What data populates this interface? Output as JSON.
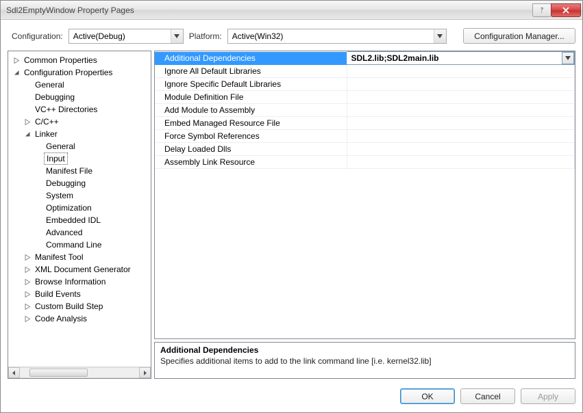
{
  "window": {
    "title": "Sdl2EmptyWindow Property Pages"
  },
  "top": {
    "config_label": "Configuration:",
    "config_value": "Active(Debug)",
    "platform_label": "Platform:",
    "platform_value": "Active(Win32)",
    "config_mgr_label": "Configuration Manager..."
  },
  "tree": {
    "items": [
      {
        "level": 0,
        "expander": "closed",
        "label": "Common Properties"
      },
      {
        "level": 0,
        "expander": "open",
        "label": "Configuration Properties"
      },
      {
        "level": 1,
        "expander": "none",
        "label": "General"
      },
      {
        "level": 1,
        "expander": "none",
        "label": "Debugging"
      },
      {
        "level": 1,
        "expander": "none",
        "label": "VC++ Directories"
      },
      {
        "level": 1,
        "expander": "closed",
        "label": "C/C++"
      },
      {
        "level": 1,
        "expander": "open",
        "label": "Linker"
      },
      {
        "level": 2,
        "expander": "none",
        "label": "General"
      },
      {
        "level": 2,
        "expander": "none",
        "label": "Input",
        "selected": true
      },
      {
        "level": 2,
        "expander": "none",
        "label": "Manifest File"
      },
      {
        "level": 2,
        "expander": "none",
        "label": "Debugging"
      },
      {
        "level": 2,
        "expander": "none",
        "label": "System"
      },
      {
        "level": 2,
        "expander": "none",
        "label": "Optimization"
      },
      {
        "level": 2,
        "expander": "none",
        "label": "Embedded IDL"
      },
      {
        "level": 2,
        "expander": "none",
        "label": "Advanced"
      },
      {
        "level": 2,
        "expander": "none",
        "label": "Command Line"
      },
      {
        "level": 1,
        "expander": "closed",
        "label": "Manifest Tool"
      },
      {
        "level": 1,
        "expander": "closed",
        "label": "XML Document Generator"
      },
      {
        "level": 1,
        "expander": "closed",
        "label": "Browse Information"
      },
      {
        "level": 1,
        "expander": "closed",
        "label": "Build Events"
      },
      {
        "level": 1,
        "expander": "closed",
        "label": "Custom Build Step"
      },
      {
        "level": 1,
        "expander": "closed",
        "label": "Code Analysis"
      }
    ]
  },
  "grid": {
    "rows": [
      {
        "name": "Additional Dependencies",
        "value": "SDL2.lib;SDL2main.lib",
        "selected": true
      },
      {
        "name": "Ignore All Default Libraries",
        "value": ""
      },
      {
        "name": "Ignore Specific Default Libraries",
        "value": ""
      },
      {
        "name": "Module Definition File",
        "value": ""
      },
      {
        "name": "Add Module to Assembly",
        "value": ""
      },
      {
        "name": "Embed Managed Resource File",
        "value": ""
      },
      {
        "name": "Force Symbol References",
        "value": ""
      },
      {
        "name": "Delay Loaded Dlls",
        "value": ""
      },
      {
        "name": "Assembly Link Resource",
        "value": ""
      }
    ]
  },
  "desc": {
    "title": "Additional Dependencies",
    "text": "Specifies additional items to add to the link command line [i.e. kernel32.lib]"
  },
  "footer": {
    "ok": "OK",
    "cancel": "Cancel",
    "apply": "Apply"
  }
}
